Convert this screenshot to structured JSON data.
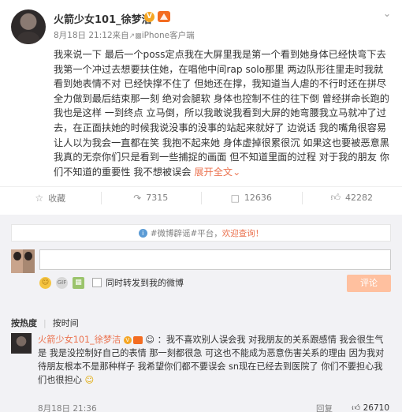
{
  "post": {
    "author": "火箭少女101_徐梦洁",
    "meta": "8月18日 21:12来自",
    "device": "iPhone客户端",
    "content": "我来说一下 最后一个poss定点我在大屏里我是第一个看到她身体已经快弯下去 我第一个冲过去想要扶住她，在唱他中间rap solo那里 两边队形往里走时我就看到她表情不对 已经快撑不住了 但她还在撑，我知道当人虐的不行时还在拼尽全力做到最后结束那一刻 绝对会腿软 身体也控制不住的往下倒 曾经拼命长跑的我也是这样 一到终点 立马倒，所以我敢说我看到大屏的她弯腰我立马就冲了过去，在正面扶她的时候我说没事的没事的站起来就好了 边说话 我的嘴角很容易让人以为我会一直都在笑 我抱不起来她 身体虚掉很累很沉 如果这也要被恶意黑 我真的无奈你们只是看到一些捕捉的画面 但不知道里面的过程 对于我的朋友 你们不知道的重要性 我不想被误会",
    "expand": "展开全文",
    "actions": {
      "collect": "收藏",
      "forward": "7315",
      "comment": "12636",
      "like": "42282"
    }
  },
  "comment_area": {
    "notice_prefix": "#微博辟谣#平台，",
    "notice_link": "欢迎查询！",
    "sync_label": "同时转发到我的微博",
    "submit": "评论",
    "sort_hot": "按热度",
    "sort_time": "按时间",
    "first_comment": {
      "author": "火箭少女101_徐梦洁",
      "text": "：我不喜欢别人误会我 对我朋友的关系跟感情 我会很生气是 我是没控制好自己的表情 那一刻都很急 可这也不能成为恶意伤害关系的理由 因为我对待朋友根本不是那种样子 我希望你们都不要误会 sn现在已经去到医院了 你们不要担心我们也很担心",
      "time": "8月18日 21:36",
      "reply": "回复",
      "likes": "26710"
    }
  }
}
